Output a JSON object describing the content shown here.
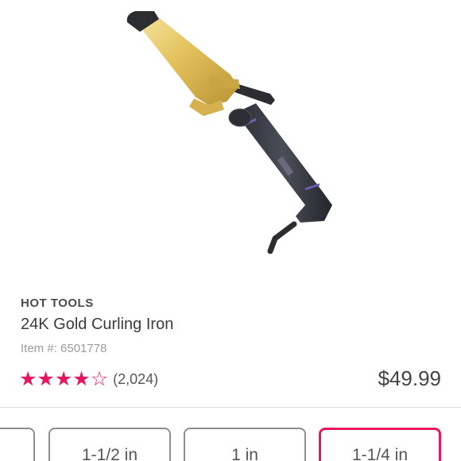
{
  "product": {
    "brand": "HOT TOOLS",
    "name": "24K Gold Curling Iron",
    "item_number": "Item #: 6501778",
    "rating": 4,
    "rating_max": 5,
    "review_count": "(2,024)",
    "price": "$49.99",
    "image_icon": "curling-iron-image"
  },
  "size_options": [
    {
      "label": "",
      "selected": false
    },
    {
      "label": "1-1/2 in",
      "selected": false
    },
    {
      "label": "1 in",
      "selected": false
    },
    {
      "label": "1-1/4 in",
      "selected": true
    }
  ],
  "colors": {
    "accent": "#e8175d",
    "text_dark": "#3b3b3b",
    "text_muted": "#9a9a9a",
    "border": "#8e8e8e"
  }
}
